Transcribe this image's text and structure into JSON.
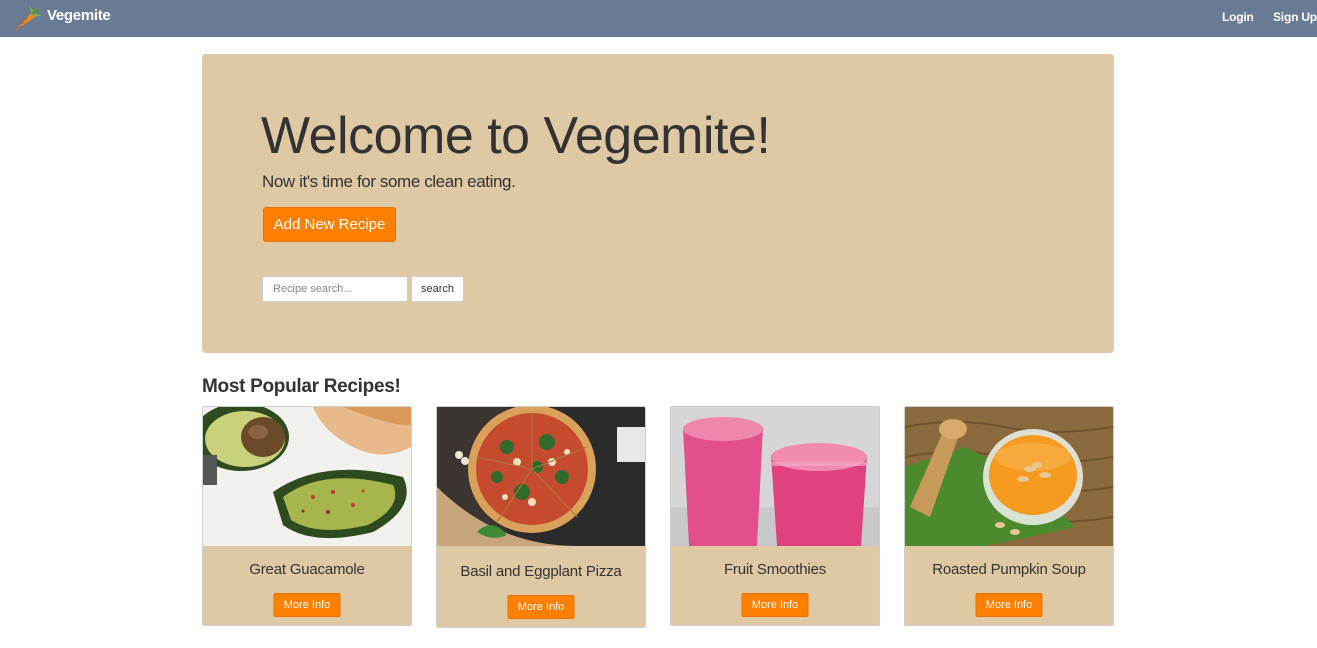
{
  "navbar": {
    "brand": "Vegemite",
    "brand_icon": "carrot-icon",
    "links": {
      "login": "Login",
      "signup": "Sign Up"
    }
  },
  "hero": {
    "heading": "Welcome to Vegemite!",
    "tagline": "Now it's time for some clean eating.",
    "add_button": "Add New Recipe",
    "search_placeholder": "Recipe search...",
    "search_button": "search"
  },
  "popular": {
    "title": "Most Popular Recipes!",
    "cards": [
      {
        "title": "Great Guacamole",
        "button": "More Info",
        "image": "avocado-guacamole-photo"
      },
      {
        "title": "Basil and Eggplant Pizza",
        "button": "More Info",
        "image": "pizza-photo"
      },
      {
        "title": "Fruit Smoothies",
        "button": "More Info",
        "image": "pink-smoothies-photo"
      },
      {
        "title": "Roasted Pumpkin Soup",
        "button": "More Info",
        "image": "pumpkin-soup-jar-photo"
      }
    ]
  },
  "colors": {
    "navbar": "#687a94",
    "panel": "#dfc8a4",
    "accent": "#ff8000"
  }
}
